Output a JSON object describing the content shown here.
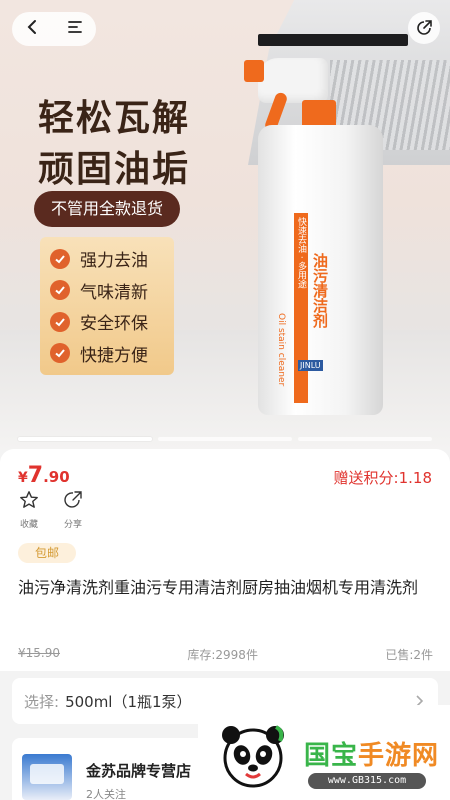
{
  "nav": {
    "back_icon": "chevron-left-icon",
    "menu_icon": "menu-icon",
    "share_icon": "share-icon"
  },
  "banner": {
    "headline_line1": "轻松瓦解",
    "headline_line2": "顽固油垢",
    "refund_badge": "不管用全款退货",
    "benefits": [
      "强力去油",
      "气味清新",
      "安全环保",
      "快捷方便"
    ],
    "product_name_on_bottle": "油污清洁剂",
    "product_en_on_bottle": "Oil stain cleaner",
    "bottle_strip_text": "快速去油 · 多用途",
    "bottle_brand": "JINLU",
    "slide_count": 3,
    "active_slide": 0
  },
  "product": {
    "price_currency": "¥",
    "price_int": "7",
    "price_dec": ".90",
    "points_label": "赠送积分:1.18",
    "favorite_label": "收藏",
    "share_label": "分享",
    "tag": "包邮",
    "title": "油污净清洗剂重油污专用清洁剂厨房抽油烟机专用清洗剂",
    "original_price": "¥15.90",
    "stock": "库存:2998件",
    "sold": "已售:2件"
  },
  "spec": {
    "label": "选择:",
    "value": "500ml（1瓶1泵）",
    "arrow_icon": "chevron-right-icon"
  },
  "store": {
    "name": "金苏品牌专营店",
    "followers": "2人关注"
  },
  "watermark": {
    "brand_a": "国宝",
    "brand_b": "手游网",
    "url": "www.GB315.com"
  },
  "colors": {
    "accent_red": "#e0332e",
    "brand_orange": "#ef6a1d",
    "headline_brown": "#3a2417"
  }
}
